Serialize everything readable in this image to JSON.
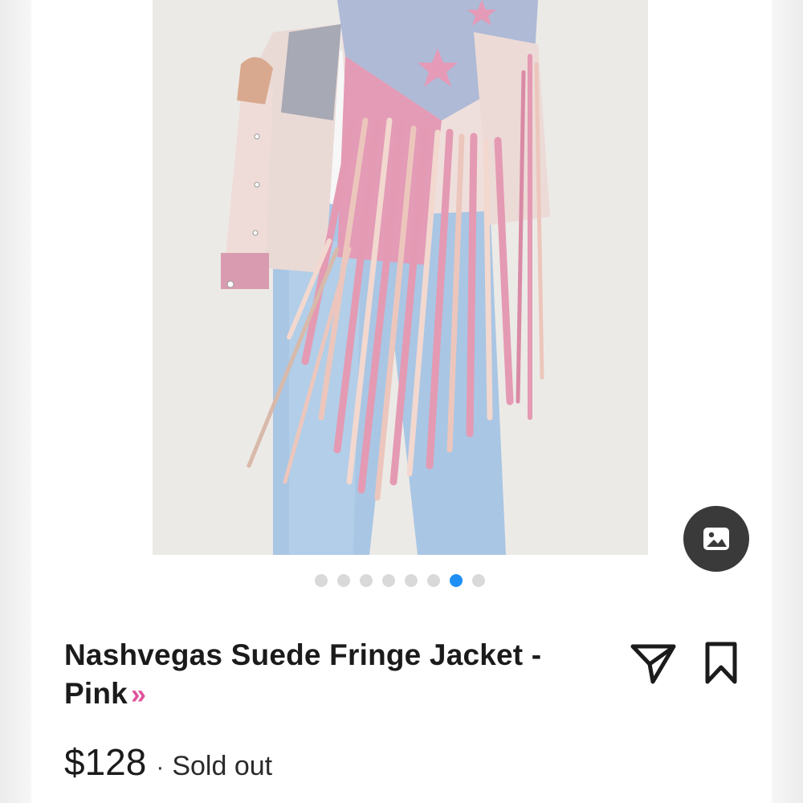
{
  "product": {
    "title": "Nashvegas Suede Fringe Jacket - Pink",
    "more_glyph": "»",
    "price": "$128",
    "separator": "·",
    "status": "Sold out"
  },
  "gallery": {
    "total_images": 8,
    "active_index": 6
  },
  "icons": {
    "image_view": "image-icon",
    "share": "send-icon",
    "save": "bookmark-icon"
  },
  "colors": {
    "active_dot": "#1f8ff5",
    "inactive_dot": "#d9d9d9",
    "accent_chevron": "#e0539b",
    "text": "#1b1b1b"
  }
}
